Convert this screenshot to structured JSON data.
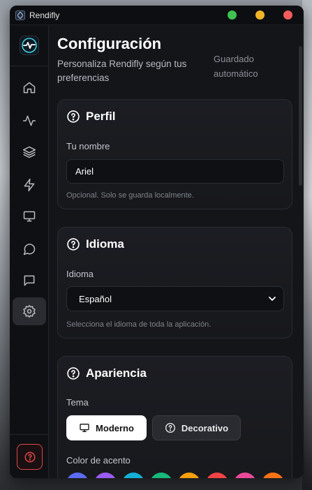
{
  "app": {
    "title": "Rendifly"
  },
  "window_controls": {
    "colors": [
      "#3fc252",
      "#f0b429",
      "#f25c5c"
    ]
  },
  "sidebar": {
    "items": [
      {
        "icon": "home-icon"
      },
      {
        "icon": "activity-icon"
      },
      {
        "icon": "layers-icon"
      },
      {
        "icon": "zap-icon"
      },
      {
        "icon": "monitor-icon"
      },
      {
        "icon": "message-circle-icon"
      },
      {
        "icon": "message-square-icon"
      },
      {
        "icon": "gear-icon",
        "active": true
      }
    ],
    "help_icon": "help-circle-icon"
  },
  "header": {
    "title": "Configuración",
    "subtitle": "Personaliza Rendifly según tus preferencias",
    "autosave": "Guardado automático"
  },
  "profile": {
    "title": "Perfil",
    "name_label": "Tu nombre",
    "name_value": "Ariel",
    "hint": "Opcional. Solo se guarda localmente."
  },
  "language": {
    "title": "Idioma",
    "label": "Idioma",
    "selected": "Español",
    "hint": "Selecciona el idioma de toda la aplicación."
  },
  "appearance": {
    "title": "Apariencia",
    "theme_label": "Tema",
    "themes": [
      {
        "label": "Moderno",
        "selected": true
      },
      {
        "label": "Decorativo",
        "selected": false
      }
    ],
    "accent_label": "Color de acento",
    "accent_colors": [
      "#5b6cf5",
      "#9b5cf5",
      "#14b0d6",
      "#17b87a",
      "#f5a00e",
      "#ef4444",
      "#ec4899",
      "#f97316"
    ]
  }
}
